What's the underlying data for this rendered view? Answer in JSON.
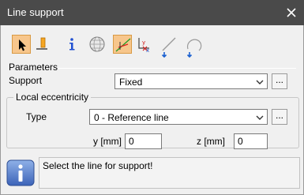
{
  "window": {
    "title": "Line support"
  },
  "toolbar": {
    "tools": [
      {
        "name": "select-pointer-icon",
        "active": true
      },
      {
        "name": "pin-icon",
        "active": false
      },
      {
        "name": "info-icon",
        "active": false
      },
      {
        "name": "globe-icon",
        "active": false
      },
      {
        "name": "line-support-icon",
        "active": true
      },
      {
        "name": "coordinate-system-icon",
        "active": false
      },
      {
        "name": "line-arrow-icon",
        "active": false
      },
      {
        "name": "arc-arrow-icon",
        "active": false
      }
    ]
  },
  "parameters": {
    "section_label": "Parameters",
    "support_label": "Support",
    "support_value": "Fixed",
    "browse_label": "..."
  },
  "eccentricity": {
    "group_label": "Local eccentricity",
    "type_label": "Type",
    "type_value": "0 - Reference line",
    "browse_label": "...",
    "y_label": "y [mm]",
    "y_value": "0",
    "z_label": "z [mm]",
    "z_value": "0"
  },
  "status": {
    "message": "Select the line for support!"
  }
}
